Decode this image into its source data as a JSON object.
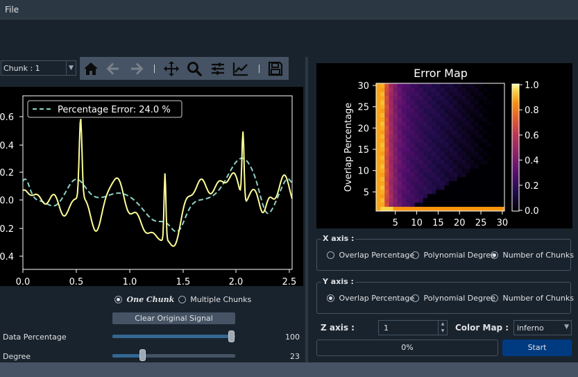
{
  "menu": {
    "file": "File"
  },
  "chunk_combo": {
    "value": "Chunk : 1"
  },
  "toolbar": {
    "icons": [
      "home-icon",
      "back-arrow-icon",
      "forward-arrow-icon",
      "pan-move-icon",
      "zoom-magnifier-icon",
      "configure-subplots-icon",
      "edit-axis-curves-icon",
      "save-floppy-icon"
    ]
  },
  "left_chart": {
    "legend": "Percentage Error: 24.0 %",
    "xticks": [
      "0.0",
      "0.5",
      "1.0",
      "1.5",
      "2.0",
      "2.5"
    ],
    "yticks": [
      "0.6",
      "0.4",
      "0.2",
      "0.0",
      "0.2",
      "0.4"
    ]
  },
  "chunk_mode": {
    "option1": "One Chunk",
    "option2": "Multiple Chunks",
    "selected": "One Chunk"
  },
  "clear_button": "Clear Original Signal",
  "data_percentage": {
    "label": "Data Percentage",
    "value": "100",
    "fraction": 1.0
  },
  "degree": {
    "label": "Degree",
    "value": "23",
    "fraction": 0.23
  },
  "error_map": {
    "title": "Error Map",
    "ylabel": "Overlap Percentage",
    "xticks": [
      "5",
      "10",
      "15",
      "20",
      "25",
      "30"
    ],
    "yticks": [
      "30",
      "25",
      "20",
      "15",
      "10",
      "5"
    ],
    "cbar_ticks": [
      "1.0",
      "0.8",
      "0.6",
      "0.4",
      "0.2",
      "0.0"
    ]
  },
  "x_axis_group": {
    "title": "X axis :",
    "options": [
      "Overlap Percentage",
      "Polynomial Degree",
      "Number of Chunks"
    ],
    "selected": "Number of Chunks"
  },
  "y_axis_group": {
    "title": "Y axis :",
    "options": [
      "Overlap Percentage",
      "Polynomial Degree",
      "Number of Chunks"
    ],
    "selected": "Overlap Percentage"
  },
  "z_axis": {
    "label": "Z axis :",
    "value": "1"
  },
  "color_map": {
    "label": "Color Map :",
    "value": "inferno"
  },
  "progress": {
    "text": "0%",
    "value": 0
  },
  "start_button": "Start",
  "colors": {
    "accent": "#003a80",
    "background": "#19232d",
    "panel": "#455364",
    "signal": "#ffff99",
    "fit": "#8dd3c7"
  }
}
